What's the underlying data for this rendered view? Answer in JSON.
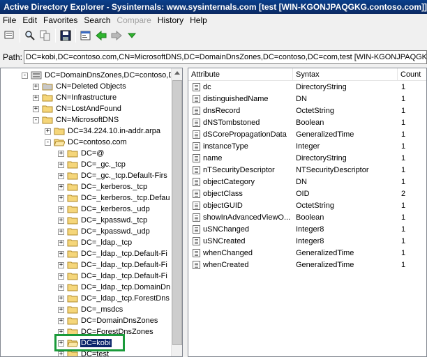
{
  "window": {
    "title": "Active Directory Explorer - Sysinternals: www.sysinternals.com [test [WIN-KGONJPAQGKG.contoso.com]]"
  },
  "menu": [
    {
      "label": "File",
      "enabled": true
    },
    {
      "label": "Edit",
      "enabled": true
    },
    {
      "label": "Favorites",
      "enabled": true
    },
    {
      "label": "Search",
      "enabled": true
    },
    {
      "label": "Compare",
      "enabled": false
    },
    {
      "label": "History",
      "enabled": true
    },
    {
      "label": "Help",
      "enabled": true
    }
  ],
  "toolbar": {
    "icons": [
      "connect-icon",
      "search-icon",
      "compare-icon",
      "save-icon",
      "properties-icon",
      "back-arrow-icon",
      "forward-arrow-icon",
      "history-dropdown-icon"
    ]
  },
  "path": {
    "label": "Path:",
    "value": "DC=kobi,DC=contoso.com,CN=MicrosoftDNS,DC=DomainDnsZones,DC=contoso,DC=com,test [WIN-KGONJPAQGKG.co"
  },
  "tree": [
    {
      "label": "DC=DomainDnsZones,DC=contoso,DC",
      "level": 0,
      "expander": "-",
      "icon": "partition"
    },
    {
      "label": "CN=Deleted Objects",
      "level": 1,
      "expander": "+",
      "icon": "gray-folder"
    },
    {
      "label": "CN=Infrastructure",
      "level": 1,
      "expander": "+",
      "icon": "folder"
    },
    {
      "label": "CN=LostAndFound",
      "level": 1,
      "expander": "+",
      "icon": "folder"
    },
    {
      "label": "CN=MicrosoftDNS",
      "level": 1,
      "expander": "-",
      "icon": "folder"
    },
    {
      "label": "DC=34.224.10.in-addr.arpa",
      "level": 2,
      "expander": "+",
      "icon": "folder"
    },
    {
      "label": "DC=contoso.com",
      "level": 2,
      "expander": "-",
      "icon": "open-folder"
    },
    {
      "label": "DC=@",
      "level": 3,
      "expander": "+",
      "icon": "folder"
    },
    {
      "label": "DC=_gc._tcp",
      "level": 3,
      "expander": "+",
      "icon": "folder"
    },
    {
      "label": "DC=_gc._tcp.Default-Firs",
      "level": 3,
      "expander": "+",
      "icon": "folder"
    },
    {
      "label": "DC=_kerberos._tcp",
      "level": 3,
      "expander": "+",
      "icon": "folder"
    },
    {
      "label": "DC=_kerberos._tcp.Defau",
      "level": 3,
      "expander": "+",
      "icon": "folder"
    },
    {
      "label": "DC=_kerberos._udp",
      "level": 3,
      "expander": "+",
      "icon": "folder"
    },
    {
      "label": "DC=_kpasswd._tcp",
      "level": 3,
      "expander": "+",
      "icon": "folder"
    },
    {
      "label": "DC=_kpasswd._udp",
      "level": 3,
      "expander": "+",
      "icon": "folder"
    },
    {
      "label": "DC=_ldap._tcp",
      "level": 3,
      "expander": "+",
      "icon": "folder"
    },
    {
      "label": "DC=_ldap._tcp.Default-Fi",
      "level": 3,
      "expander": "+",
      "icon": "folder"
    },
    {
      "label": "DC=_ldap._tcp.Default-Fi",
      "level": 3,
      "expander": "+",
      "icon": "folder"
    },
    {
      "label": "DC=_ldap._tcp.Default-Fi",
      "level": 3,
      "expander": "+",
      "icon": "folder"
    },
    {
      "label": "DC=_ldap._tcp.DomainDn",
      "level": 3,
      "expander": "+",
      "icon": "folder"
    },
    {
      "label": "DC=_ldap._tcp.ForestDns",
      "level": 3,
      "expander": "+",
      "icon": "folder"
    },
    {
      "label": "DC=_msdcs",
      "level": 3,
      "expander": "+",
      "icon": "folder"
    },
    {
      "label": "DC=DomainDnsZones",
      "level": 3,
      "expander": "+",
      "icon": "folder"
    },
    {
      "label": "DC=ForestDnsZones",
      "level": 3,
      "expander": "+",
      "icon": "folder"
    },
    {
      "label": "DC=kobi",
      "level": 3,
      "expander": "+",
      "icon": "open-folder",
      "selected": true
    },
    {
      "label": "DC=test",
      "level": 3,
      "expander": "+",
      "icon": "folder"
    }
  ],
  "grid": {
    "columns": [
      "Attribute",
      "Syntax",
      "Count"
    ],
    "rows": [
      {
        "attribute": "dc",
        "syntax": "DirectoryString",
        "count": "1"
      },
      {
        "attribute": "distinguishedName",
        "syntax": "DN",
        "count": "1"
      },
      {
        "attribute": "dnsRecord",
        "syntax": "OctetString",
        "count": "1"
      },
      {
        "attribute": "dNSTombstoned",
        "syntax": "Boolean",
        "count": "1"
      },
      {
        "attribute": "dSCorePropagationData",
        "syntax": "GeneralizedTime",
        "count": "1"
      },
      {
        "attribute": "instanceType",
        "syntax": "Integer",
        "count": "1"
      },
      {
        "attribute": "name",
        "syntax": "DirectoryString",
        "count": "1"
      },
      {
        "attribute": "nTSecurityDescriptor",
        "syntax": "NTSecurityDescriptor",
        "count": "1"
      },
      {
        "attribute": "objectCategory",
        "syntax": "DN",
        "count": "1"
      },
      {
        "attribute": "objectClass",
        "syntax": "OID",
        "count": "2"
      },
      {
        "attribute": "objectGUID",
        "syntax": "OctetString",
        "count": "1"
      },
      {
        "attribute": "showInAdvancedViewO...",
        "syntax": "Boolean",
        "count": "1"
      },
      {
        "attribute": "uSNChanged",
        "syntax": "Integer8",
        "count": "1"
      },
      {
        "attribute": "uSNCreated",
        "syntax": "Integer8",
        "count": "1"
      },
      {
        "attribute": "whenChanged",
        "syntax": "GeneralizedTime",
        "count": "1"
      },
      {
        "attribute": "whenCreated",
        "syntax": "GeneralizedTime",
        "count": "1"
      }
    ]
  },
  "colors": {
    "titlebar": "#0b2a63",
    "selection": "#0a246a",
    "highlight_box": "#1a9a3a",
    "folder": "#f5d67a"
  }
}
